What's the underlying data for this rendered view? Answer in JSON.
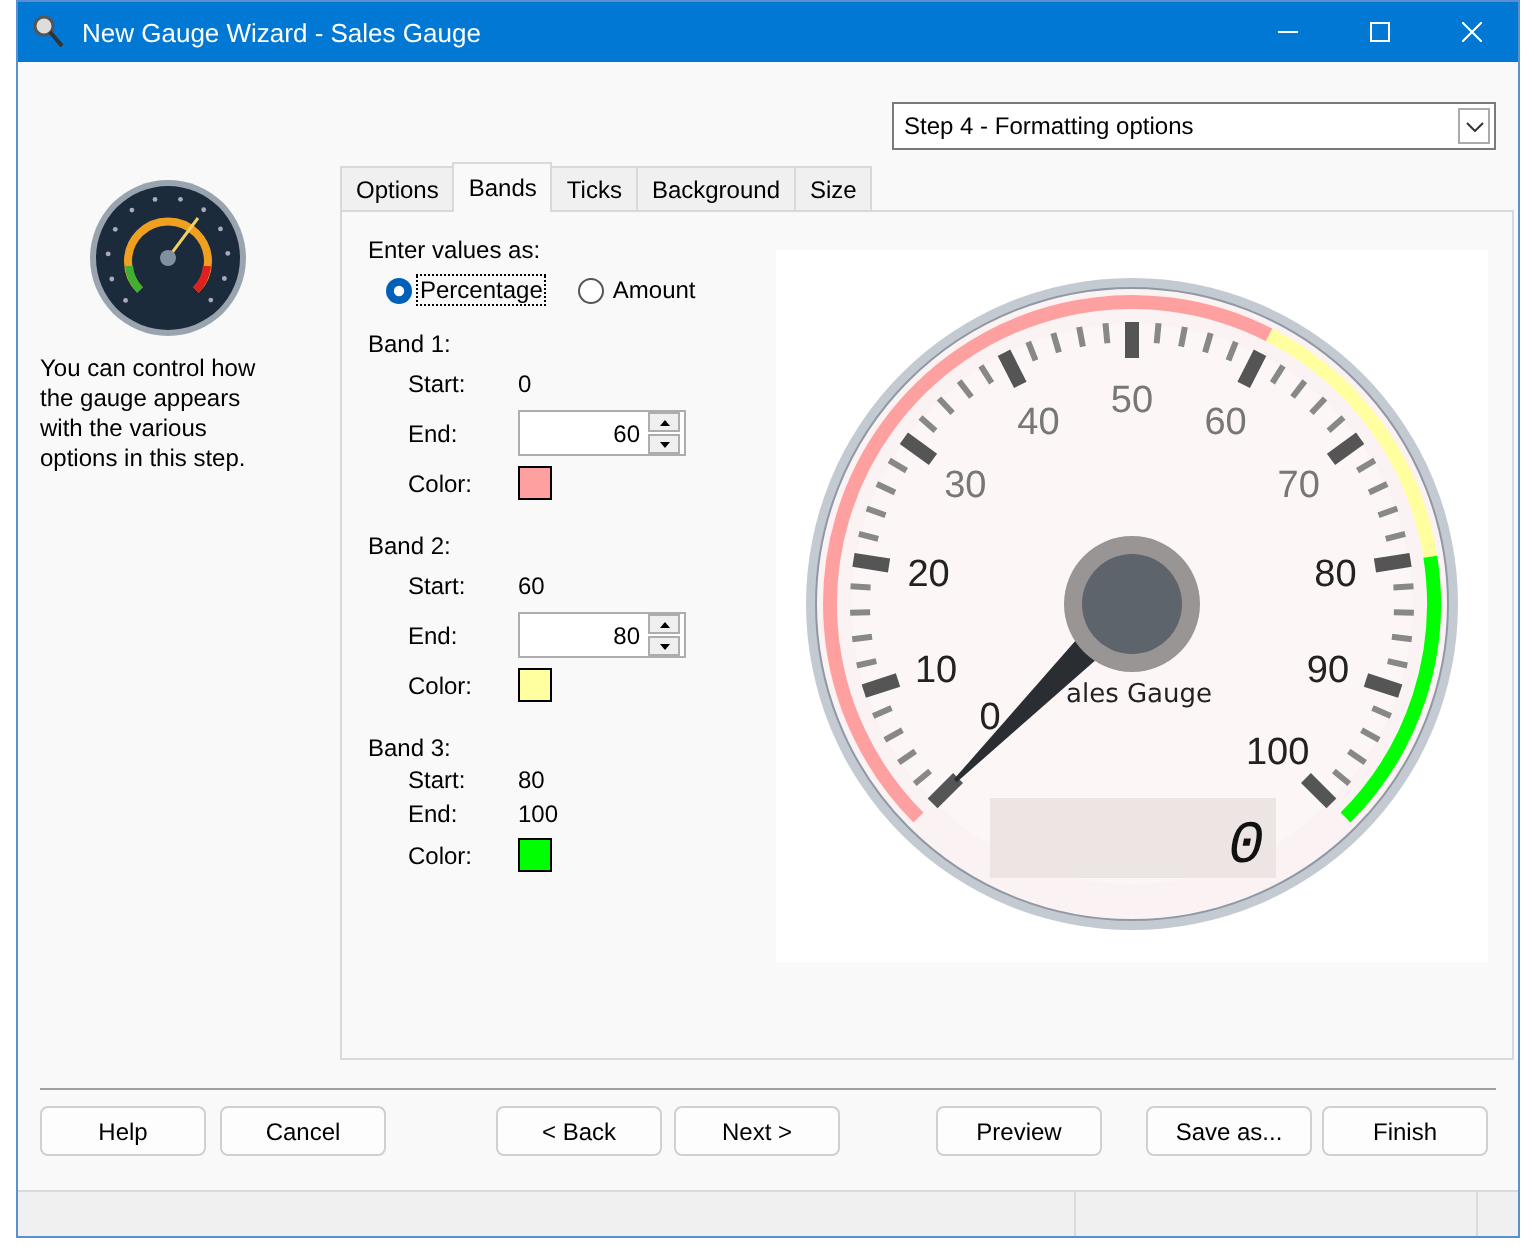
{
  "window": {
    "title": "New Gauge Wizard - Sales Gauge"
  },
  "step_select": {
    "value": "Step 4 - Formatting options"
  },
  "description": "You can control how the gauge appears with the various options in this step.",
  "tabs": [
    {
      "label": "Options",
      "selected": false
    },
    {
      "label": "Bands",
      "selected": true
    },
    {
      "label": "Ticks",
      "selected": false
    },
    {
      "label": "Background",
      "selected": false
    },
    {
      "label": "Size",
      "selected": false
    }
  ],
  "values_as": {
    "label": "Enter values as:",
    "options": [
      {
        "label": "Percentage",
        "selected": true
      },
      {
        "label": "Amount",
        "selected": false
      }
    ]
  },
  "bands": [
    {
      "title": "Band 1:",
      "start_label": "Start:",
      "start": "0",
      "end_label": "End:",
      "end": "60",
      "kind": "spin",
      "color_label": "Color:",
      "color": "#ffa0a0"
    },
    {
      "title": "Band 2:",
      "start_label": "Start:",
      "start": "60",
      "end_label": "End:",
      "end": "80",
      "kind": "spin",
      "color_label": "Color:",
      "color": "#ffff9f"
    },
    {
      "title": "Band 3:",
      "start_label": "Start:",
      "start": "80",
      "end_label": "End:",
      "end": "100",
      "kind": "text",
      "color_label": "Color:",
      "color": "#00ff00"
    }
  ],
  "gauge": {
    "title": "ales Gauge",
    "scale_labels": [
      "0",
      "10",
      "20",
      "30",
      "40",
      "50",
      "60",
      "70",
      "80",
      "90",
      "100"
    ],
    "readout": "0"
  },
  "buttons": [
    {
      "label": "Help"
    },
    {
      "label": "Cancel"
    },
    {
      "label": "< Back"
    },
    {
      "label": "Next >"
    },
    {
      "label": "Preview"
    },
    {
      "label": "Save as..."
    },
    {
      "label": "Finish"
    }
  ]
}
